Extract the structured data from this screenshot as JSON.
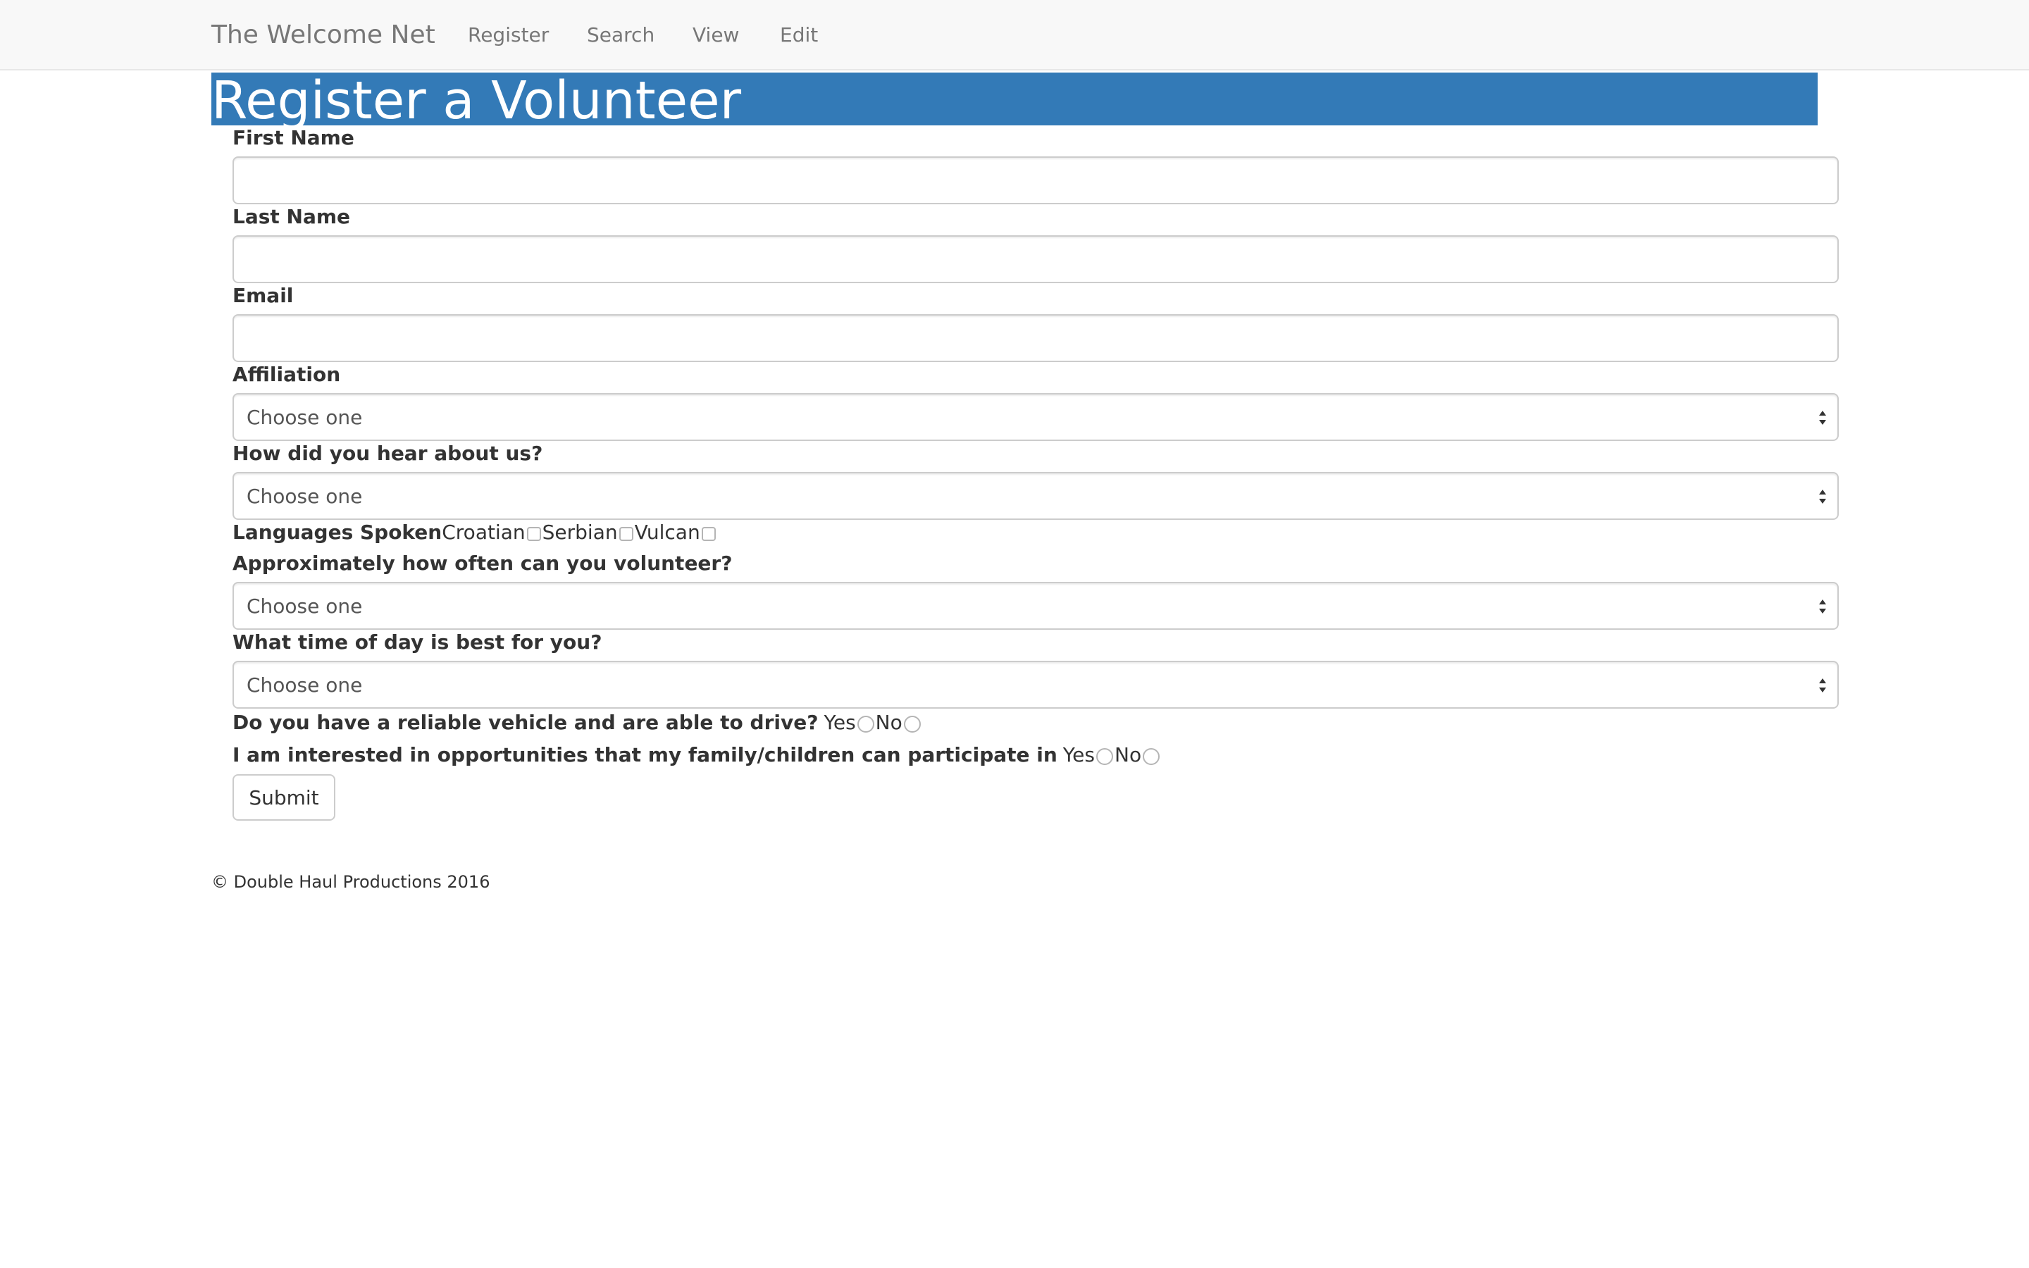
{
  "navbar": {
    "brand": "The Welcome Net",
    "items": [
      {
        "label": "Register"
      },
      {
        "label": "Search"
      },
      {
        "label": "View"
      },
      {
        "label": "Edit"
      }
    ]
  },
  "page": {
    "title": "Register a Volunteer"
  },
  "form": {
    "first_name": {
      "label": "First Name",
      "value": ""
    },
    "last_name": {
      "label": "Last Name",
      "value": ""
    },
    "email": {
      "label": "Email",
      "value": ""
    },
    "affiliation": {
      "label": "Affiliation",
      "selected": "Choose one"
    },
    "heard_about": {
      "label": "How did you hear about us?",
      "selected": "Choose one"
    },
    "languages": {
      "label": "Languages Spoken",
      "options": [
        {
          "label": "Croatian",
          "checked": false
        },
        {
          "label": "Serbian",
          "checked": false
        },
        {
          "label": "Vulcan",
          "checked": false
        }
      ]
    },
    "frequency": {
      "label": "Approximately how often can you volunteer?",
      "selected": "Choose one"
    },
    "time_of_day": {
      "label": "What time of day is best for you?",
      "selected": "Choose one"
    },
    "vehicle": {
      "label": "Do you have a reliable vehicle and are able to drive?",
      "options": [
        {
          "label": "Yes"
        },
        {
          "label": "No"
        }
      ]
    },
    "family": {
      "label": "I am interested in opportunities that my family/children can participate in",
      "options": [
        {
          "label": "Yes"
        },
        {
          "label": "No"
        }
      ]
    },
    "submit_label": "Submit"
  },
  "footer": {
    "text": "© Double Haul Productions 2016"
  },
  "colors": {
    "title_bar": "#337ab7",
    "navbar_bg": "#f8f8f8"
  }
}
